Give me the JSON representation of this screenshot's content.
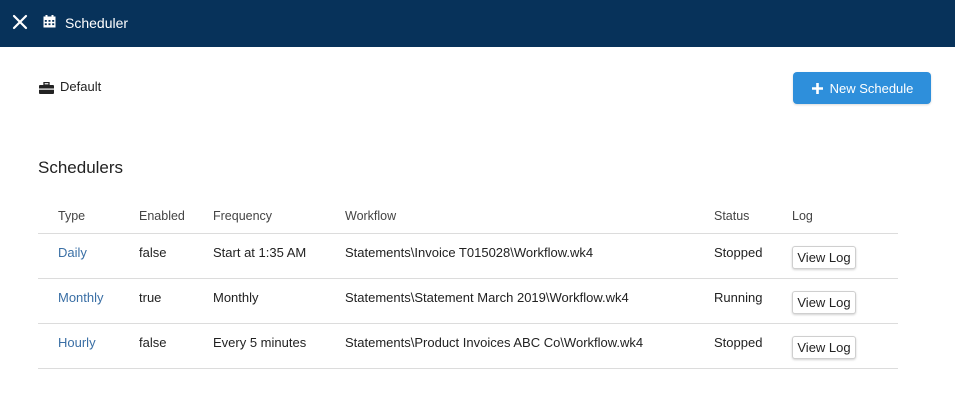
{
  "window": {
    "title": "Scheduler"
  },
  "workspace": {
    "label": "Default"
  },
  "toolbar": {
    "new_schedule_label": "New Schedule",
    "accent_color": "#2e8fdb",
    "titlebar_color": "#07325a"
  },
  "section": {
    "title": "Schedulers"
  },
  "table": {
    "headers": {
      "type": "Type",
      "enabled": "Enabled",
      "frequency": "Frequency",
      "workflow": "Workflow",
      "status": "Status",
      "log": "Log"
    },
    "rows": [
      {
        "type": "Daily",
        "enabled": "false",
        "frequency": "Start at 1:35 AM",
        "workflow": "Statements\\Invoice T015028\\Workflow.wk4",
        "status": "Stopped",
        "log": "View Log"
      },
      {
        "type": "Monthly",
        "enabled": "true",
        "frequency": "Monthly",
        "workflow": "Statements\\Statement March 2019\\Workflow.wk4",
        "status": "Running",
        "log": "View Log"
      },
      {
        "type": "Hourly",
        "enabled": "false",
        "frequency": "Every 5 minutes",
        "workflow": "Statements\\Product Invoices ABC Co\\Workflow.wk4",
        "status": "Stopped",
        "log": "View Log"
      }
    ]
  },
  "icons": {
    "close": "close-icon",
    "calendar": "calendar-icon",
    "workspace": "briefcase-icon",
    "add": "plus-icon"
  }
}
